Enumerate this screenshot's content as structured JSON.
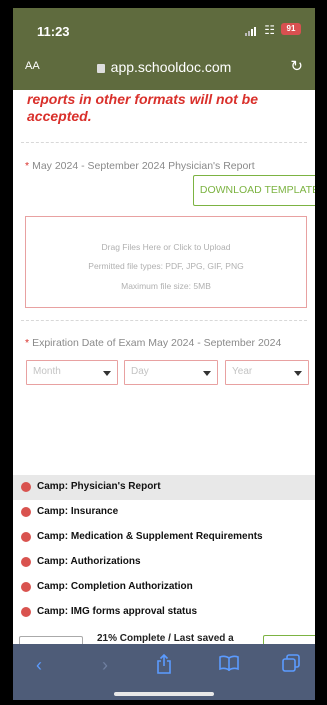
{
  "status_bar": {
    "time": "11:23",
    "battery": "91"
  },
  "browser": {
    "text_size_label": "AA",
    "url": "app.schooldoc.com"
  },
  "page": {
    "warning": "reports in other formats will not be accepted.",
    "report_field": {
      "label": "May 2024 - September 2024 Physician's Report",
      "download_label": "DOWNLOAD TEMPLATE",
      "upload_title": "Drag Files Here or Click to Upload",
      "upload_types": "Permitted file types: PDF, JPG, GIF, PNG",
      "upload_size": "Maximum file size: 5MB"
    },
    "expiration_field": {
      "label": "Expiration Date of Exam May 2024 - September 2024",
      "month_placeholder": "Month",
      "day_placeholder": "Day",
      "year_placeholder": "Year"
    }
  },
  "checklist": [
    {
      "label": "Camp: Physician's Report",
      "active": true
    },
    {
      "label": "Camp: Insurance",
      "active": false
    },
    {
      "label": "Camp: Medication & Supplement Requirements",
      "active": false
    },
    {
      "label": "Camp: Authorizations",
      "active": false
    },
    {
      "label": "Camp: Completion Authorization",
      "active": false
    },
    {
      "label": "Camp: IMG forms approval status",
      "active": false
    }
  ],
  "progress_text": "21% Complete / Last saved a",
  "toolbar_icons": [
    "back-icon",
    "forward-icon",
    "share-icon",
    "bookmarks-icon",
    "tabs-icon"
  ],
  "colors": {
    "header": "#5f6b3e",
    "accent_green": "#7cb342",
    "required_red": "#d9302b",
    "toolbar": "#4e5c78"
  }
}
